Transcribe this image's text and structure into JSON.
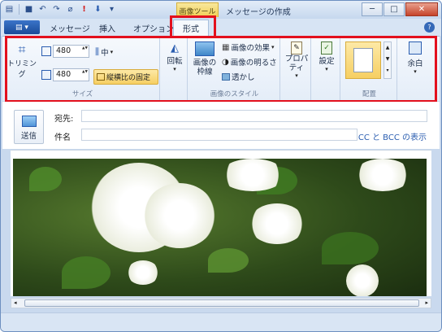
{
  "titlebar": {
    "title": "メッセージの作成",
    "tool_context": "画像ツール",
    "quick_access": [
      "save-icon",
      "undo-icon",
      "redo-icon",
      "attach-icon",
      "priority-high-icon",
      "priority-low-icon",
      "customize-icon"
    ]
  },
  "window_controls": {
    "minimize": "─",
    "maximize": "□",
    "close": "✕"
  },
  "tabs": {
    "file_menu": "▤ ▾",
    "items": [
      "メッセージ",
      "挿入",
      "オプション",
      "形式"
    ],
    "active": "形式"
  },
  "ribbon": {
    "size_group": {
      "label": "サイズ",
      "crop": "トリミング",
      "width_value": "480",
      "height_value": "480",
      "align": "中",
      "lock_ratio": "縦横比の固定"
    },
    "rotate": "回転",
    "style_group": {
      "label": "画像のスタイル",
      "frame": "画像の\n枠線",
      "effects": "画像の効果",
      "brightness": "画像の明るさ",
      "transparency": "透かし"
    },
    "properties": "プロパ\nティ",
    "settings": "設定",
    "position_group": {
      "label": "配置"
    },
    "margin": "余白"
  },
  "compose": {
    "send": "送信",
    "to_label": "宛先:",
    "to_value": "",
    "subject_label": "件名",
    "subject_value": "",
    "cc_bcc_link": "CC と BCC の表示"
  },
  "colors": {
    "highlight": "#e3101d",
    "accent": "#2a5db0"
  }
}
